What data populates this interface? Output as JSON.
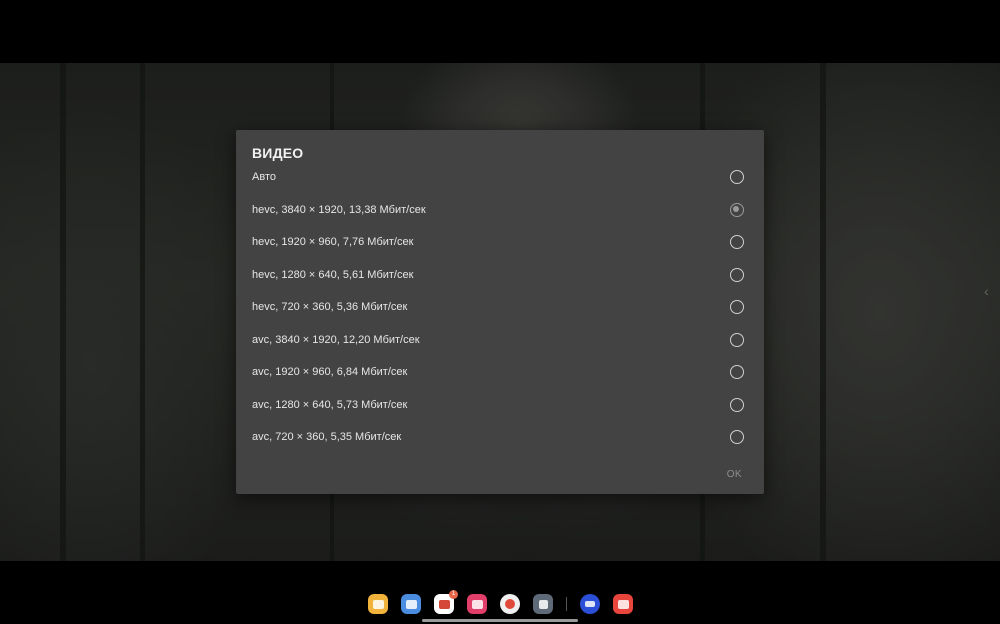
{
  "dialog": {
    "title": "ВИДЕО",
    "options": [
      {
        "label": "Авто",
        "selected": false
      },
      {
        "label": "hevc, 3840 × 1920, 13,38 Мбит/сек",
        "selected": true
      },
      {
        "label": "hevc, 1920 × 960, 7,76 Мбит/сек",
        "selected": false
      },
      {
        "label": "hevc, 1280 × 640, 5,61 Мбит/сек",
        "selected": false
      },
      {
        "label": "hevc, 720 × 360, 5,36 Мбит/сек",
        "selected": false
      },
      {
        "label": "avc, 3840 × 1920, 12,20 Мбит/сек",
        "selected": false
      },
      {
        "label": "avc, 1920 × 960, 6,84 Мбит/сек",
        "selected": false
      },
      {
        "label": "avc, 1280 × 640, 5,73 Мбит/сек",
        "selected": false
      },
      {
        "label": "avc, 720 × 360, 5,35 Мбит/сек",
        "selected": false
      }
    ],
    "ok_label": "OK"
  },
  "video": {
    "edge_arrow": "‹"
  },
  "taskbar": {
    "apps": [
      {
        "name": "files-app-icon",
        "color": "#f2b33c"
      },
      {
        "name": "calendar-app-icon",
        "color": "#4a8de0"
      },
      {
        "name": "gmail-app-icon",
        "color": "#ffffff",
        "badge": "1"
      },
      {
        "name": "screen-recorder-app-icon",
        "color": "#e23e6a"
      },
      {
        "name": "chrome-app-icon",
        "color": "#f0f0f0"
      },
      {
        "name": "app-drawer-icon",
        "color": "#5f6a78"
      },
      {
        "name": "smart-view-app-icon",
        "color": "#2b4fd6"
      },
      {
        "name": "notes-app-icon",
        "color": "#e8453c"
      }
    ]
  }
}
